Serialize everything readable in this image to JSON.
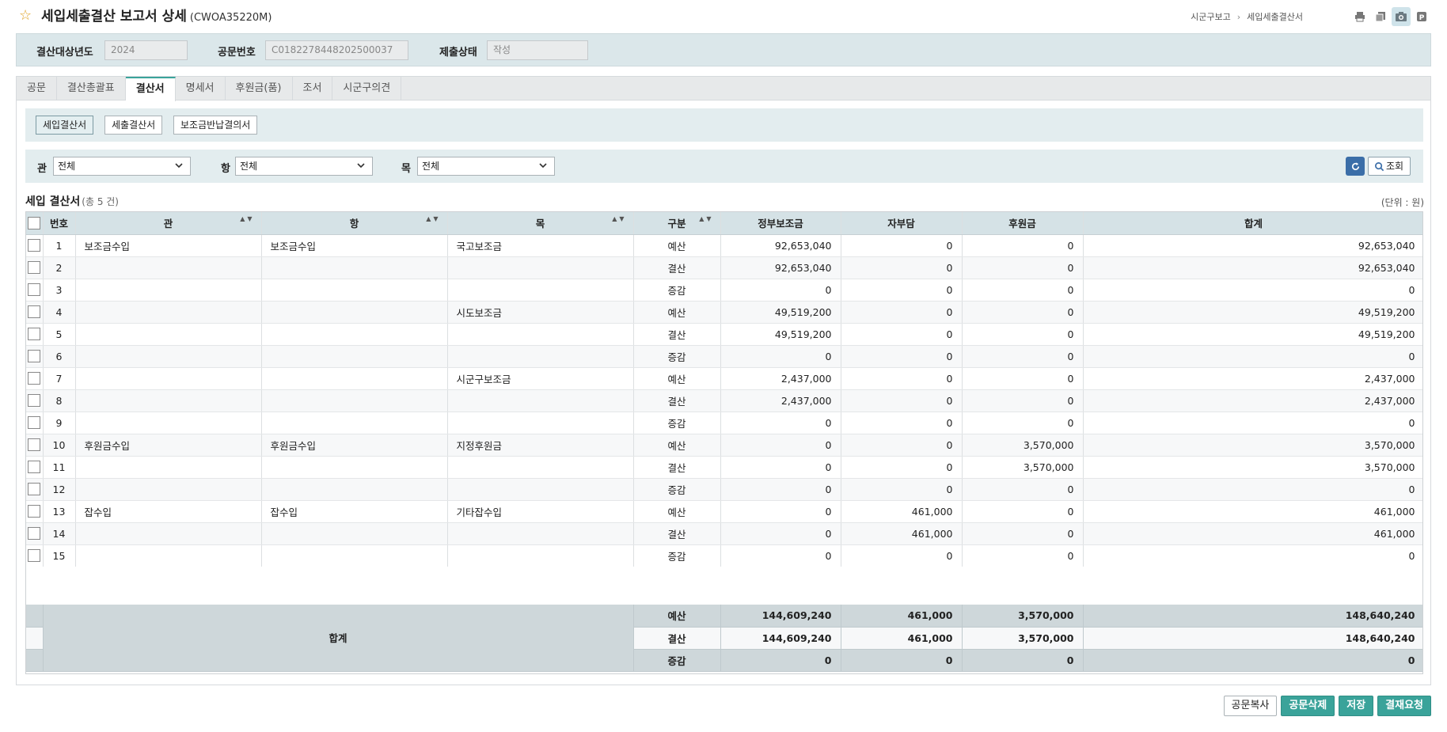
{
  "header": {
    "title": "세입세출결산 보고서 상세",
    "code": "(CWOA35220M)",
    "breadcrumb": [
      "시군구보고",
      "세입세출결산서"
    ],
    "icons": [
      "print-icon",
      "copy-icon",
      "camera-icon",
      "sub-icon"
    ]
  },
  "conditions": {
    "year_label": "결산대상년도",
    "year_value": "2024",
    "doc_label": "공문번호",
    "doc_value": "C0182278448202500037",
    "status_label": "제출상태",
    "status_value": "작성"
  },
  "tabs": [
    {
      "label": "공문",
      "active": false
    },
    {
      "label": "결산총괄표",
      "active": false
    },
    {
      "label": "결산서",
      "active": true
    },
    {
      "label": "명세서",
      "active": false
    },
    {
      "label": "후원금(품)",
      "active": false
    },
    {
      "label": "조서",
      "active": false
    },
    {
      "label": "시군구의견",
      "active": false
    }
  ],
  "sub_buttons": [
    {
      "label": "세입결산서",
      "active": true
    },
    {
      "label": "세출결산서",
      "active": false
    },
    {
      "label": "보조금반납결의서",
      "active": false
    }
  ],
  "filter": {
    "gwan_label": "관",
    "gwan_value": "전체",
    "hang_label": "항",
    "hang_value": "전체",
    "mok_label": "목",
    "mok_value": "전체",
    "search_label": "조회"
  },
  "grid": {
    "title": "세입 결산서",
    "count": "(총 5 건)",
    "unit": "(단위 : 원)",
    "columns": [
      "번호",
      "관",
      "항",
      "목",
      "구분",
      "정부보조금",
      "자부담",
      "후원금",
      "합계"
    ],
    "rows": [
      [
        "1",
        "보조금수입",
        "보조금수입",
        "국고보조금",
        "예산",
        "92,653,040",
        "0",
        "0",
        "92,653,040"
      ],
      [
        "2",
        "",
        "",
        "",
        "결산",
        "92,653,040",
        "0",
        "0",
        "92,653,040"
      ],
      [
        "3",
        "",
        "",
        "",
        "증감",
        "0",
        "0",
        "0",
        "0"
      ],
      [
        "4",
        "",
        "",
        "시도보조금",
        "예산",
        "49,519,200",
        "0",
        "0",
        "49,519,200"
      ],
      [
        "5",
        "",
        "",
        "",
        "결산",
        "49,519,200",
        "0",
        "0",
        "49,519,200"
      ],
      [
        "6",
        "",
        "",
        "",
        "증감",
        "0",
        "0",
        "0",
        "0"
      ],
      [
        "7",
        "",
        "",
        "시군구보조금",
        "예산",
        "2,437,000",
        "0",
        "0",
        "2,437,000"
      ],
      [
        "8",
        "",
        "",
        "",
        "결산",
        "2,437,000",
        "0",
        "0",
        "2,437,000"
      ],
      [
        "9",
        "",
        "",
        "",
        "증감",
        "0",
        "0",
        "0",
        "0"
      ],
      [
        "10",
        "후원금수입",
        "후원금수입",
        "지정후원금",
        "예산",
        "0",
        "0",
        "3,570,000",
        "3,570,000"
      ],
      [
        "11",
        "",
        "",
        "",
        "결산",
        "0",
        "0",
        "3,570,000",
        "3,570,000"
      ],
      [
        "12",
        "",
        "",
        "",
        "증감",
        "0",
        "0",
        "0",
        "0"
      ],
      [
        "13",
        "잡수입",
        "잡수입",
        "기타잡수입",
        "예산",
        "0",
        "461,000",
        "0",
        "461,000"
      ],
      [
        "14",
        "",
        "",
        "",
        "결산",
        "0",
        "461,000",
        "0",
        "461,000"
      ],
      [
        "15",
        "",
        "",
        "",
        "증감",
        "0",
        "0",
        "0",
        "0"
      ]
    ],
    "footer_label": "합계",
    "footer": [
      [
        "예산",
        "144,609,240",
        "461,000",
        "3,570,000",
        "148,640,240"
      ],
      [
        "결산",
        "144,609,240",
        "461,000",
        "3,570,000",
        "148,640,240"
      ],
      [
        "증감",
        "0",
        "0",
        "0",
        "0"
      ]
    ]
  },
  "actions": [
    {
      "label": "공문복사",
      "style": "plain"
    },
    {
      "label": "공문삭제",
      "style": "primary"
    },
    {
      "label": "저장",
      "style": "primary"
    },
    {
      "label": "결재요청",
      "style": "primary"
    }
  ]
}
